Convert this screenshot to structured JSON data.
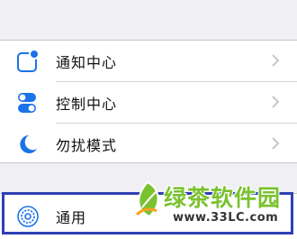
{
  "settings": {
    "items": [
      {
        "label": "通知中心",
        "icon": "notification-center-icon"
      },
      {
        "label": "控制中心",
        "icon": "control-center-icon"
      },
      {
        "label": "勿扰模式",
        "icon": "moon-icon"
      }
    ],
    "general": {
      "label": "通用",
      "icon": "gear-icon"
    }
  },
  "watermark": {
    "brand": "绿茶软件园",
    "url": "www.33LC.com"
  },
  "colors": {
    "background": "#efeff4",
    "highlight_border": "#2f3fb4",
    "icon_blue": "#1a73e8",
    "watermark_green": "#7ac230"
  }
}
